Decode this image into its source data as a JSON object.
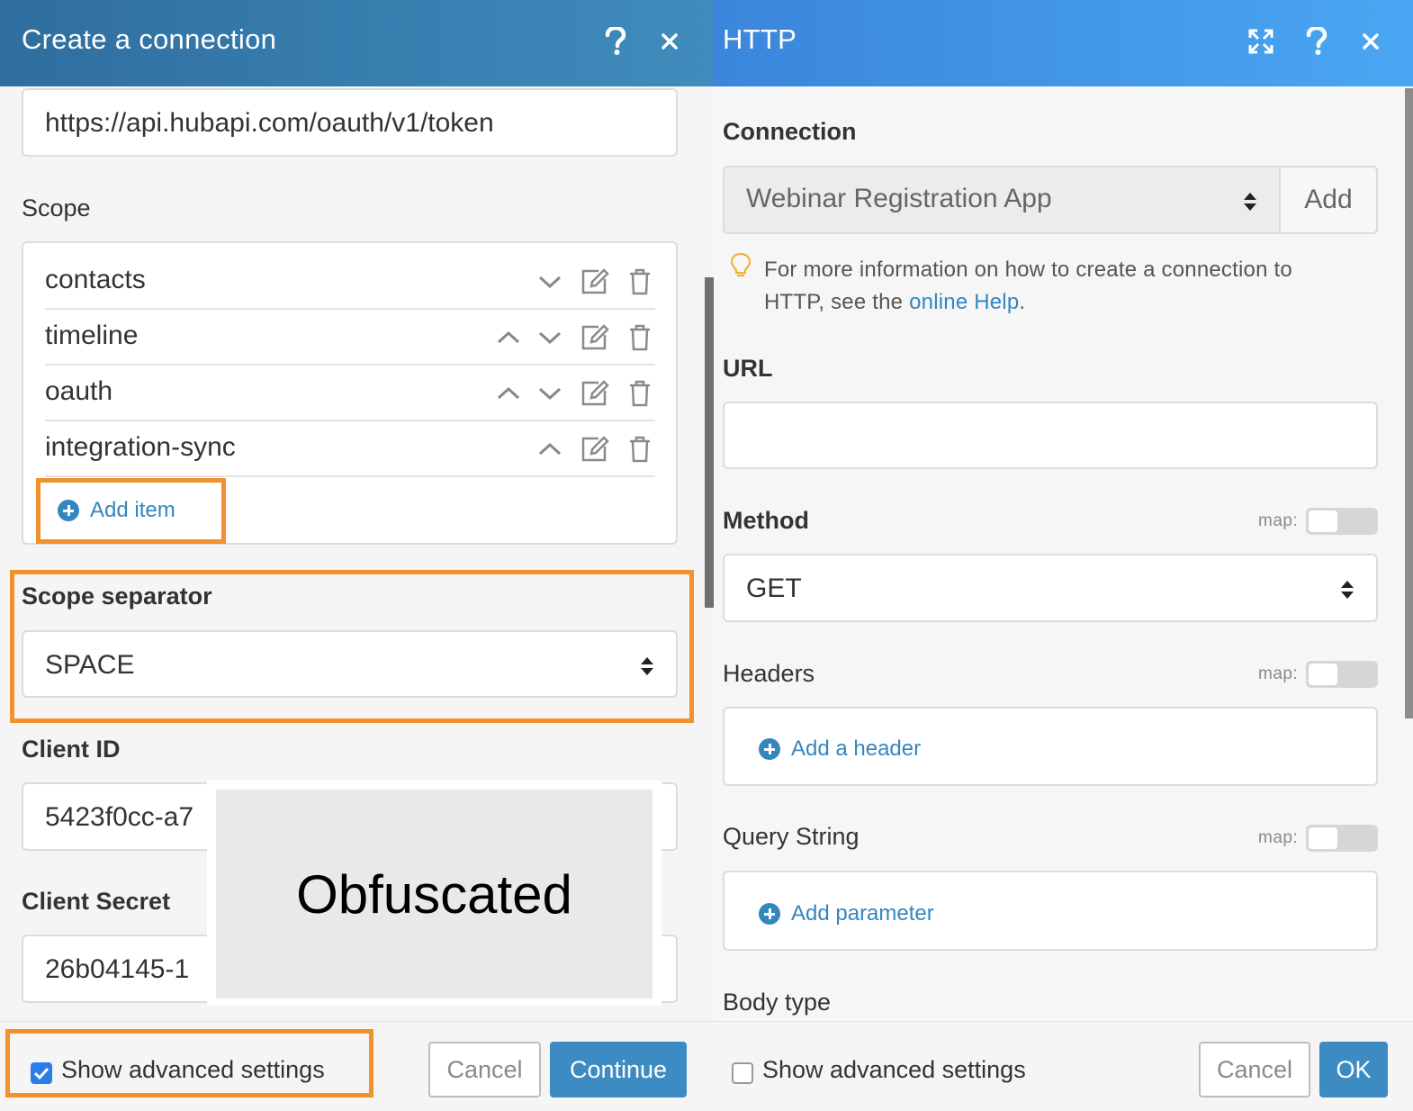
{
  "left": {
    "title": "Create a connection",
    "token_url_value": "https://api.hubapi.com/oauth/v1/token",
    "scope_label": "Scope",
    "scope_items": [
      {
        "label": "contacts"
      },
      {
        "label": "timeline"
      },
      {
        "label": "oauth"
      },
      {
        "label": "integration-sync"
      }
    ],
    "add_item_label": "Add item",
    "scope_separator_label": "Scope separator",
    "scope_separator_value": "SPACE",
    "client_id_label": "Client ID",
    "client_id_value": "5423f0cc-a7",
    "client_secret_label": "Client Secret",
    "client_secret_value": "26b04145-1",
    "obfuscated_text": "Obfuscated",
    "show_advanced_label": "Show advanced settings",
    "show_advanced_checked": true,
    "cancel_label": "Cancel",
    "continue_label": "Continue"
  },
  "right": {
    "title": "HTTP",
    "connection_label": "Connection",
    "connection_value": "Webinar Registration App",
    "add_label": "Add",
    "help_text_prefix": "For more information on how to create a connection to",
    "help_text_line2": "HTTP, see the ",
    "help_link": "online Help",
    "help_text_suffix": ".",
    "url_label": "URL",
    "url_value": "",
    "method_label": "Method",
    "map_label": "map:",
    "method_value": "GET",
    "headers_label": "Headers",
    "add_header_label": "Add a header",
    "query_label": "Query String",
    "add_parameter_label": "Add parameter",
    "body_type_label": "Body type",
    "show_advanced_label": "Show advanced settings",
    "show_advanced_checked": false,
    "cancel_label": "Cancel",
    "ok_label": "OK"
  },
  "colors": {
    "left_header": "#3a80b4",
    "right_header": "#4196e8",
    "accent_link": "#3486bf",
    "highlight_orange": "#f0922e",
    "primary_button": "#3d8bc3"
  },
  "icons": [
    "help-icon",
    "close-icon",
    "expand-icon",
    "chevron-down-icon",
    "chevron-up-icon",
    "edit-icon",
    "trash-icon",
    "plus-circle-icon",
    "lightbulb-icon",
    "select-arrows-icon",
    "checkbox-icon"
  ]
}
